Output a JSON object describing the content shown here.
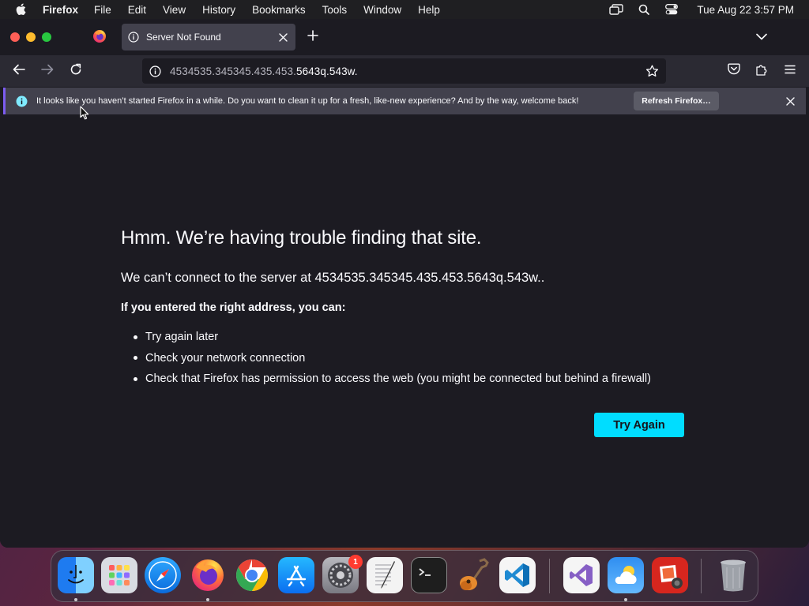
{
  "menubar": {
    "app_name": "Firefox",
    "items": [
      "File",
      "Edit",
      "View",
      "History",
      "Bookmarks",
      "Tools",
      "Window",
      "Help"
    ],
    "clock": "Tue Aug 22  3:57 PM"
  },
  "tabs": {
    "active_title": "Server Not Found"
  },
  "urlbar": {
    "url_dim": "4534535.345345.435.453.",
    "url_bright": "5643q.543w."
  },
  "notification": {
    "message": "It looks like you haven’t started Firefox in a while. Do you want to clean it up for a fresh, like-new experience? And by the way, welcome back!",
    "button_label": "Refresh Firefox…",
    "accent_color": "#7c5cf0"
  },
  "error_page": {
    "title": "Hmm. We’re having trouble finding that site.",
    "description": "We can’t connect to the server at 4534535.345345.435.453.5643q.543w..",
    "hint": "If you entered the right address, you can:",
    "suggestions": [
      "Try again later",
      "Check your network connection",
      "Check that Firefox has permission to access the web (you might be connected but behind a firewall)"
    ],
    "try_again_label": "Try Again",
    "button_color": "#00ddff"
  },
  "dock": {
    "apps": [
      "finder-icon",
      "launchpad-icon",
      "safari-icon",
      "firefox-icon",
      "chrome-icon",
      "app-store-icon",
      "system-settings-icon",
      "textedit-icon",
      "terminal-icon",
      "garageband-icon",
      "vscode-icon",
      "visual-studio-icon",
      "weather-icon",
      "photo-booth-icon",
      "trash-icon"
    ],
    "settings_badge": "1"
  }
}
